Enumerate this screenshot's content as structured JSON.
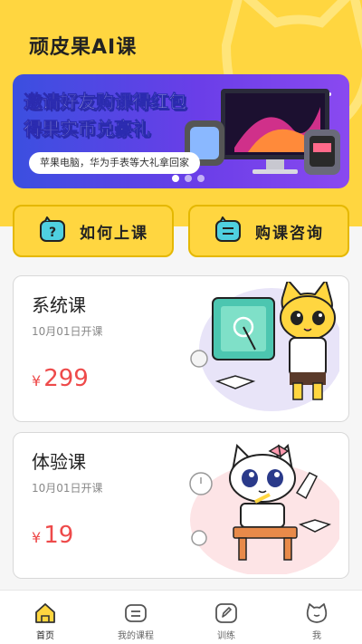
{
  "app": {
    "title": "顽皮果AI课"
  },
  "banner": {
    "line1": "邀请好友购课得红包",
    "line2": "得果实币兑豪礼",
    "pill": "苹果电脑，华为手表等大礼拿回家",
    "slides": 3,
    "active_slide": 1
  },
  "actions": [
    {
      "label": "如何上课",
      "icon": "question-icon"
    },
    {
      "label": "购课咨询",
      "icon": "chat-icon"
    }
  ],
  "courses": [
    {
      "title": "系统课",
      "date": "10月01日开课",
      "currency": "¥",
      "price": "299",
      "art": "cat-teacher-icon"
    },
    {
      "title": "体验课",
      "date": "10月01日开课",
      "currency": "¥",
      "price": "19",
      "art": "cat-student-icon"
    }
  ],
  "tabs": [
    {
      "label": "首页",
      "icon": "home-icon",
      "active": true
    },
    {
      "label": "我的课程",
      "icon": "course-icon",
      "active": false
    },
    {
      "label": "训练",
      "icon": "pencil-icon",
      "active": false
    },
    {
      "label": "我",
      "icon": "profile-icon",
      "active": false
    }
  ],
  "colors": {
    "brand_yellow": "#ffd640",
    "price_red": "#ee4a4a",
    "banner_blue": "#3b4fe0"
  }
}
